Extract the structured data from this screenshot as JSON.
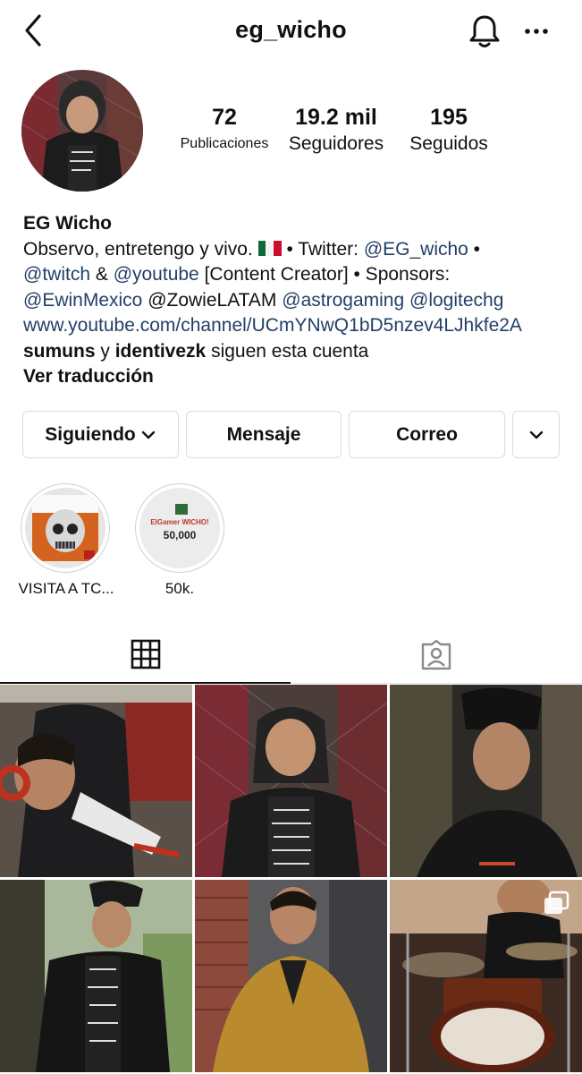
{
  "header": {
    "username": "eg_wicho",
    "back_icon": "chevron-left-icon",
    "bell_icon": "bell-icon",
    "more_icon": "more-horizontal-icon"
  },
  "stats": [
    {
      "value": "72",
      "label": "Publicaciones"
    },
    {
      "value": "19.2 mil",
      "label": "Seguidores"
    },
    {
      "value": "195",
      "label": "Seguidos"
    }
  ],
  "bio": {
    "name": "EG Wicho",
    "line1_text": "Observo, entretengo y vivo.",
    "line1_after_flag": " • Twitter: ",
    "twitter_handle": "@EG_wicho",
    "line1_end": " •",
    "twitch": "@twitch",
    "amp": " & ",
    "youtube": "@youtube",
    "line2_rest": " [Content Creator] • Sponsors:",
    "sponsor1": "@EwinMexico",
    "sponsor2": " @ZowieLATAM ",
    "sponsor3": "@astrogaming",
    "sponsor4": "@logitechg",
    "website": "www.youtube.com/channel/UCmYNwQ1bD5nzev4LJhkfe2A",
    "follower1": "sumuns",
    "followed_y": " y ",
    "follower2": "identivezk",
    "followed_suffix": " siguen esta cuenta",
    "translate": "Ver traducción"
  },
  "buttons": {
    "following": "Siguiendo",
    "message": "Mensaje",
    "email": "Correo"
  },
  "highlights": [
    {
      "label": "VISITA A TC..."
    },
    {
      "label": "50k.",
      "card_title": "ElGamer WICHO!",
      "card_count": "50,000"
    }
  ],
  "tabs": [
    "grid-icon",
    "tagged-user-icon"
  ],
  "colors": {
    "link": "#233f68",
    "border": "#dbdbdb",
    "active_tab": "#111111"
  }
}
